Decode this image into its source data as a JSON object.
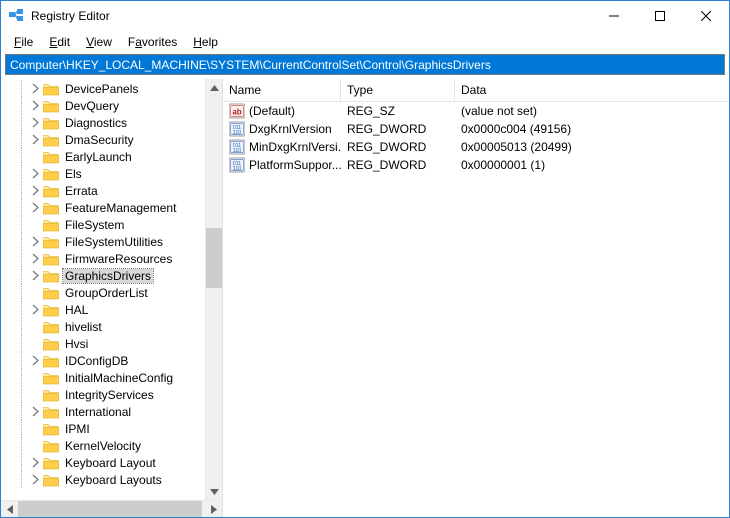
{
  "window": {
    "title": "Registry Editor"
  },
  "menu": {
    "file": "File",
    "edit": "Edit",
    "view": "View",
    "favorites": "Favorites",
    "help": "Help"
  },
  "address": "Computer\\HKEY_LOCAL_MACHINE\\SYSTEM\\CurrentControlSet\\Control\\GraphicsDrivers",
  "tree": {
    "indent": 28,
    "selected": "GraphicsDrivers",
    "items": [
      {
        "label": "DevicePanels",
        "chevron": "right",
        "topDots": true
      },
      {
        "label": "DevQuery",
        "chevron": "right"
      },
      {
        "label": "Diagnostics",
        "chevron": "right"
      },
      {
        "label": "DmaSecurity",
        "chevron": "right"
      },
      {
        "label": "EarlyLaunch",
        "chevron": "none"
      },
      {
        "label": "Els",
        "chevron": "right"
      },
      {
        "label": "Errata",
        "chevron": "right"
      },
      {
        "label": "FeatureManagement",
        "chevron": "right"
      },
      {
        "label": "FileSystem",
        "chevron": "none"
      },
      {
        "label": "FileSystemUtilities",
        "chevron": "right"
      },
      {
        "label": "FirmwareResources",
        "chevron": "right"
      },
      {
        "label": "GraphicsDrivers",
        "chevron": "right"
      },
      {
        "label": "GroupOrderList",
        "chevron": "none"
      },
      {
        "label": "HAL",
        "chevron": "right"
      },
      {
        "label": "hivelist",
        "chevron": "none"
      },
      {
        "label": "Hvsi",
        "chevron": "none"
      },
      {
        "label": "IDConfigDB",
        "chevron": "right"
      },
      {
        "label": "InitialMachineConfig",
        "chevron": "none"
      },
      {
        "label": "IntegrityServices",
        "chevron": "none"
      },
      {
        "label": "International",
        "chevron": "right"
      },
      {
        "label": "IPMI",
        "chevron": "none"
      },
      {
        "label": "KernelVelocity",
        "chevron": "none"
      },
      {
        "label": "Keyboard Layout",
        "chevron": "right"
      },
      {
        "label": "Keyboard Layouts",
        "chevron": "right"
      }
    ]
  },
  "list": {
    "columns": {
      "name": "Name",
      "type": "Type",
      "data": "Data"
    },
    "rows": [
      {
        "icon": "string",
        "name": "(Default)",
        "type": "REG_SZ",
        "data": "(value not set)"
      },
      {
        "icon": "binary",
        "name": "DxgKrnlVersion",
        "type": "REG_DWORD",
        "data": "0x0000c004 (49156)"
      },
      {
        "icon": "binary",
        "name": "MinDxgKrnlVersi...",
        "type": "REG_DWORD",
        "data": "0x00005013 (20499)"
      },
      {
        "icon": "binary",
        "name": "PlatformSuppor...",
        "type": "REG_DWORD",
        "data": "0x00000001 (1)"
      }
    ]
  },
  "scroll": {
    "vThumbTop": 132,
    "vThumbHeight": 60,
    "hThumbLeft": 0,
    "hThumbWidth": 184
  }
}
